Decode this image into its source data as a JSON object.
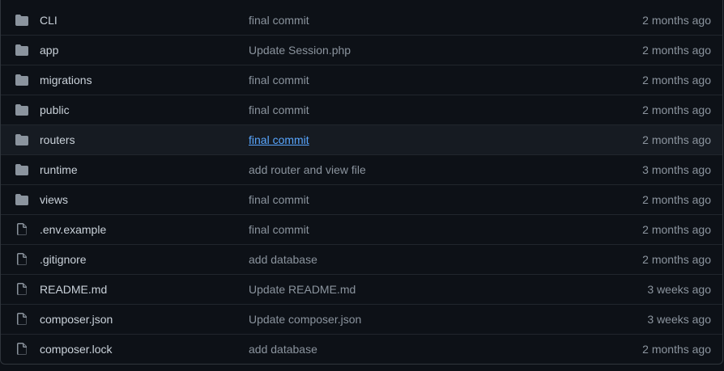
{
  "colors": {
    "background": "#0d1117",
    "row_hover": "#161b22",
    "border": "#21262d",
    "icon": "#8b949e",
    "text": "#c9d1d9",
    "muted": "#8b949e",
    "link": "#58a6ff"
  },
  "files": [
    {
      "name": "CLI",
      "type": "folder",
      "icon": "folder-icon",
      "message": "final commit",
      "age": "2 months ago"
    },
    {
      "name": "app",
      "type": "folder",
      "icon": "folder-icon",
      "message": "Update Session.php",
      "age": "2 months ago"
    },
    {
      "name": "migrations",
      "type": "folder",
      "icon": "folder-icon",
      "message": "final commit",
      "age": "2 months ago"
    },
    {
      "name": "public",
      "type": "folder",
      "icon": "folder-icon",
      "message": "final commit",
      "age": "2 months ago"
    },
    {
      "name": "routers",
      "type": "folder",
      "icon": "folder-icon",
      "message": "final commit",
      "age": "2 months ago",
      "hovered": true
    },
    {
      "name": "runtime",
      "type": "folder",
      "icon": "folder-icon",
      "message": "add router and view file",
      "age": "3 months ago"
    },
    {
      "name": "views",
      "type": "folder",
      "icon": "folder-icon",
      "message": "final commit",
      "age": "2 months ago"
    },
    {
      "name": ".env.example",
      "type": "file",
      "icon": "file-icon",
      "message": "final commit",
      "age": "2 months ago"
    },
    {
      "name": ".gitignore",
      "type": "file",
      "icon": "file-icon",
      "message": "add database",
      "age": "2 months ago"
    },
    {
      "name": "README.md",
      "type": "file",
      "icon": "file-icon",
      "message": "Update README.md",
      "age": "3 weeks ago"
    },
    {
      "name": "composer.json",
      "type": "file",
      "icon": "file-icon",
      "message": "Update composer.json",
      "age": "3 weeks ago"
    },
    {
      "name": "composer.lock",
      "type": "file",
      "icon": "file-icon",
      "message": "add database",
      "age": "2 months ago"
    }
  ]
}
